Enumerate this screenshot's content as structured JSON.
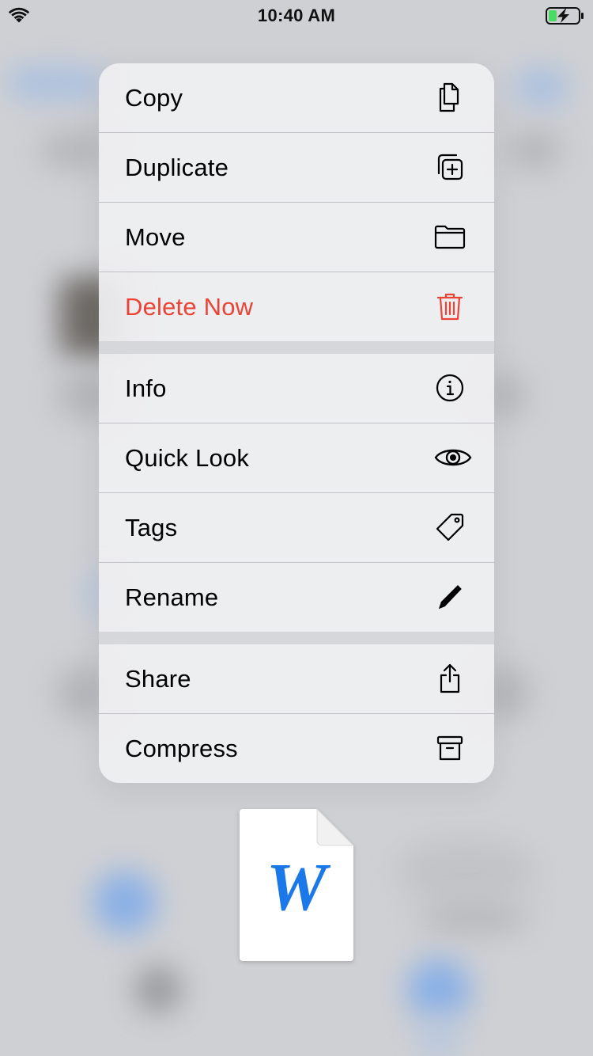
{
  "status_bar": {
    "time": "10:40 AM",
    "wifi_icon": "wifi-icon",
    "battery_icon": "battery-charging-icon"
  },
  "menu": {
    "groups": [
      {
        "items": [
          {
            "label": "Copy",
            "icon": "copy-icon"
          },
          {
            "label": "Duplicate",
            "icon": "duplicate-icon"
          },
          {
            "label": "Move",
            "icon": "folder-icon"
          },
          {
            "label": "Delete Now",
            "icon": "trash-icon",
            "destructive": true
          }
        ]
      },
      {
        "items": [
          {
            "label": "Info",
            "icon": "info-icon"
          },
          {
            "label": "Quick Look",
            "icon": "eye-icon"
          },
          {
            "label": "Tags",
            "icon": "tag-icon"
          },
          {
            "label": "Rename",
            "icon": "pencil-icon"
          }
        ]
      },
      {
        "items": [
          {
            "label": "Share",
            "icon": "share-icon"
          },
          {
            "label": "Compress",
            "icon": "archive-icon"
          }
        ]
      }
    ]
  },
  "document_preview": {
    "letter": "W",
    "icon": "word-document-icon"
  },
  "colors": {
    "destructive": "#eb4436",
    "menu_background": "#f0f0f2",
    "word_blue": "#1a78e8",
    "battery_green": "#4cd964"
  }
}
